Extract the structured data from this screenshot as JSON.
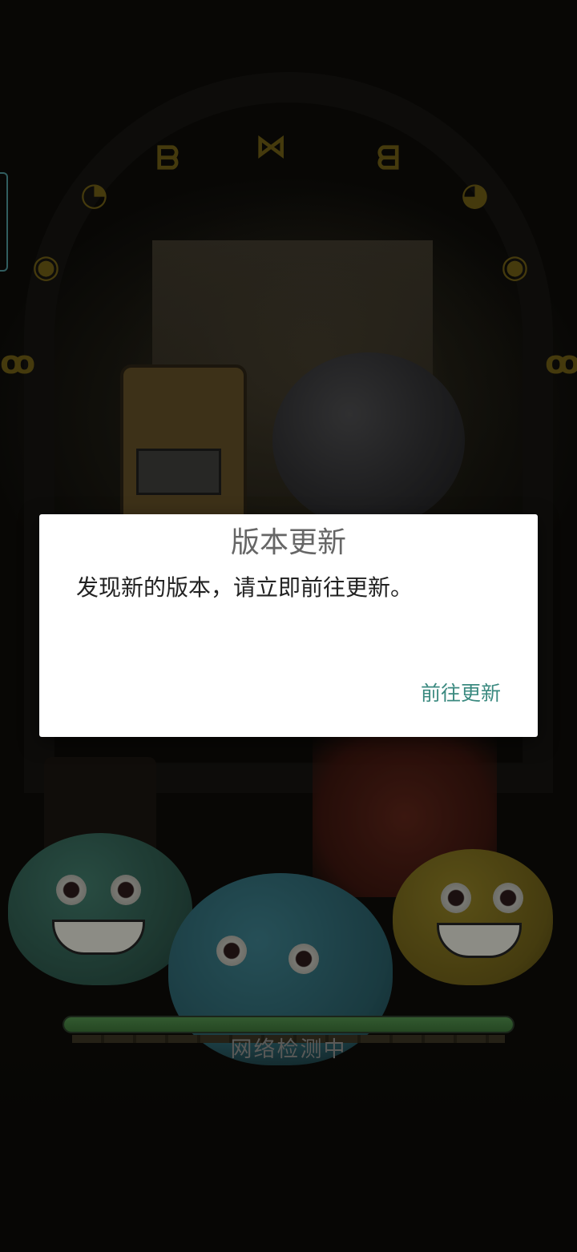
{
  "dialog": {
    "title": "版本更新",
    "message": "发现新的版本，请立即前往更新。",
    "update_button_label": "前往更新",
    "accent_color": "#3b8a80"
  },
  "loading": {
    "status_text": "网络检测中",
    "progress_percent": 100,
    "bar_color": "#4e8a4a"
  }
}
